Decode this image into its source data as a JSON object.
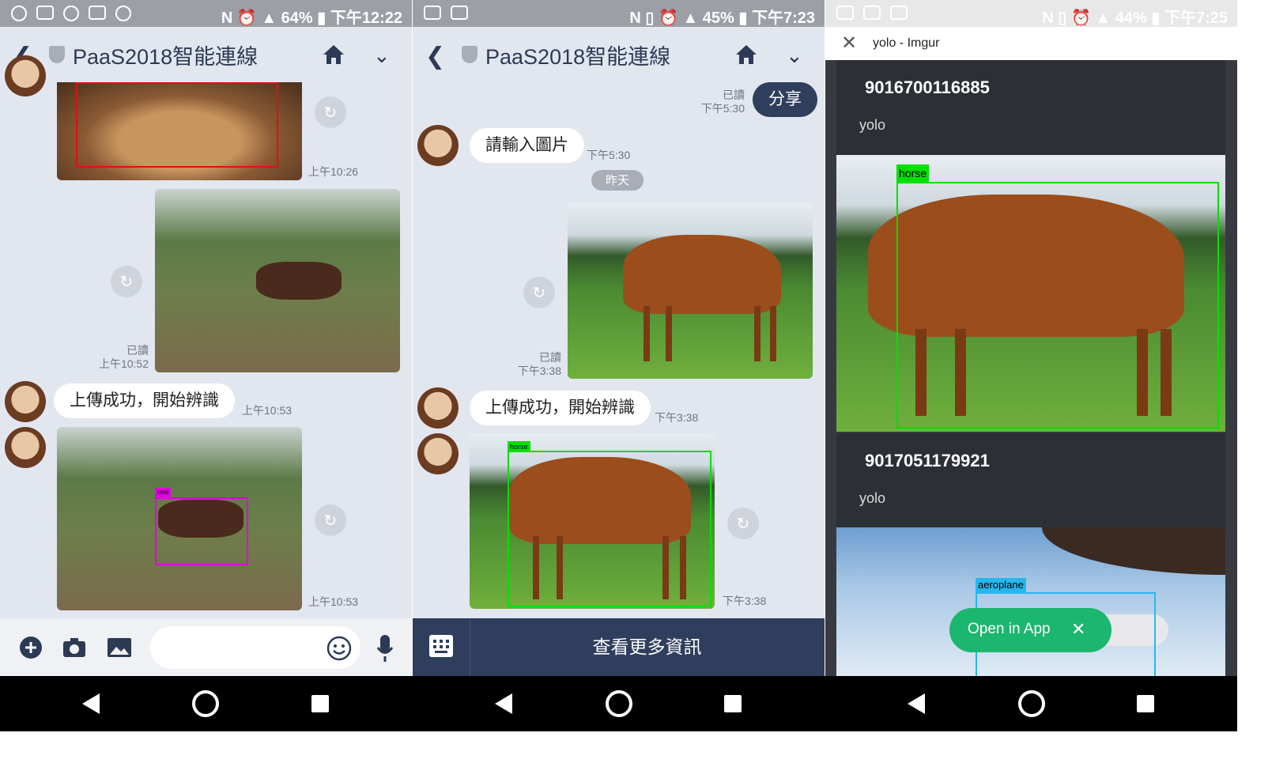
{
  "panel1": {
    "status": {
      "battery": "64%",
      "time": "下午12:22"
    },
    "header": {
      "title": "PaaS2018智能連線"
    },
    "messages": {
      "cat_time": "上午10:26",
      "sent_read": "已讀",
      "sent_time": "上午10:52",
      "reply_text": "上傳成功，開始辨識",
      "reply_time": "上午10:53",
      "result_time": "上午10:53",
      "cow_label": "cow"
    },
    "input_placeholder": ""
  },
  "panel2": {
    "status": {
      "battery": "45%",
      "time": "下午7:23"
    },
    "header": {
      "title": "PaaS2018智能連線"
    },
    "messages": {
      "share_text": "分享",
      "share_read": "已讀",
      "share_time": "下午5:30",
      "prompt_text": "請輸入圖片",
      "prompt_time": "下午5:30",
      "date_chip": "昨天",
      "sent_read": "已讀",
      "sent_time": "下午3:38",
      "reply_text": "上傳成功，開始辨識",
      "reply_time": "下午3:38",
      "result_time": "下午3:38",
      "horse_label": "horse"
    },
    "menu_label": "查看更多資訊"
  },
  "panel3": {
    "status": {
      "battery": "44%",
      "time": "下午7:25"
    },
    "browser_title": "yolo - Imgur",
    "cards": [
      {
        "id": "9016700116885",
        "title": "yolo",
        "label": "horse"
      },
      {
        "id": "9017051179921",
        "title": "yolo",
        "label": "aeroplane"
      }
    ],
    "open_app": "Open in App"
  },
  "colors": {
    "line_navy": "#2f3e5c",
    "imgur_green": "#1bb76e",
    "detect_green": "#00e000",
    "detect_magenta": "#e000e0",
    "detect_blue": "#27b7ef"
  }
}
